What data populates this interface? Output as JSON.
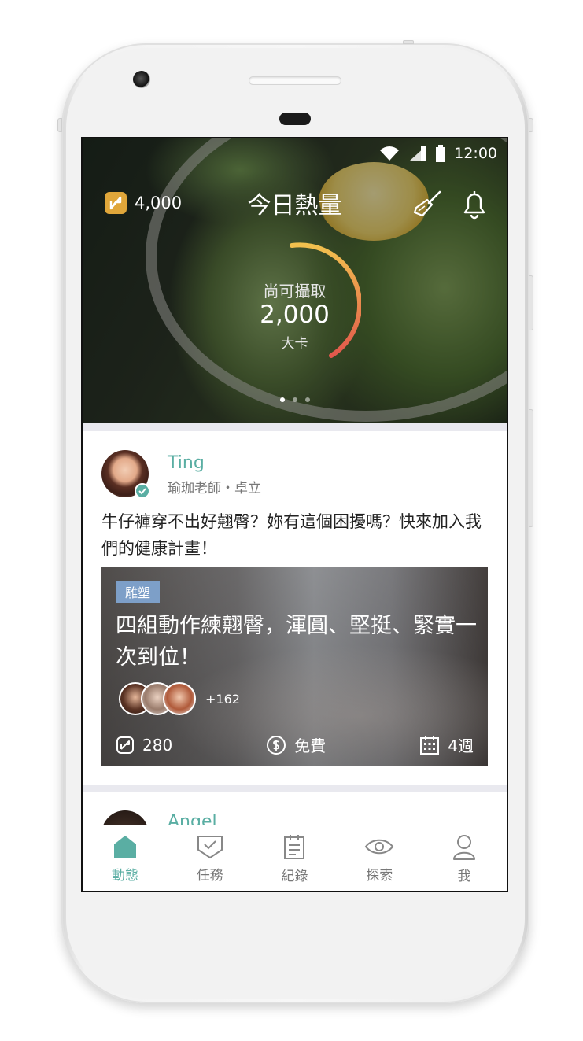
{
  "status_bar": {
    "time": "12:00",
    "icons": [
      "wifi-icon",
      "signal-icon",
      "battery-icon"
    ]
  },
  "header": {
    "title": "今日熱量",
    "coins": "4,000",
    "icons": [
      "coin-icon",
      "broom-icon",
      "bell-icon"
    ]
  },
  "calorie": {
    "label": "尚可攝取",
    "value": "2,000",
    "unit": "大卡"
  },
  "carousel": {
    "pages": 3,
    "active": 0
  },
  "posts": [
    {
      "author": "Ting",
      "meta": "瑜珈老師・卓立",
      "text": "牛仔褲穿不出好翹臀？妳有這個困擾嗎？快來加入我們的健康計畫！",
      "card": {
        "tag": "雕塑",
        "title": "四組動作練翹臀，渾圓、堅挺、緊實一次到位！",
        "participants_more": "+162",
        "stats": {
          "points": "280",
          "price": "免費",
          "duration": "4週"
        }
      }
    },
    {
      "author": "Angel"
    }
  ],
  "tabs": [
    {
      "label": "動態",
      "icon": "home-icon",
      "active": true
    },
    {
      "label": "任務",
      "icon": "task-check-icon",
      "active": false
    },
    {
      "label": "紀錄",
      "icon": "clipboard-icon",
      "active": false
    },
    {
      "label": "探索",
      "icon": "eye-icon",
      "active": false
    },
    {
      "label": "我",
      "icon": "user-icon",
      "active": false
    }
  ],
  "colors": {
    "accent": "#5aaea3",
    "coin": "#e0a63a",
    "tag": "#7d9fc8",
    "ring_start": "#f2c14e",
    "ring_end": "#e2574c"
  }
}
